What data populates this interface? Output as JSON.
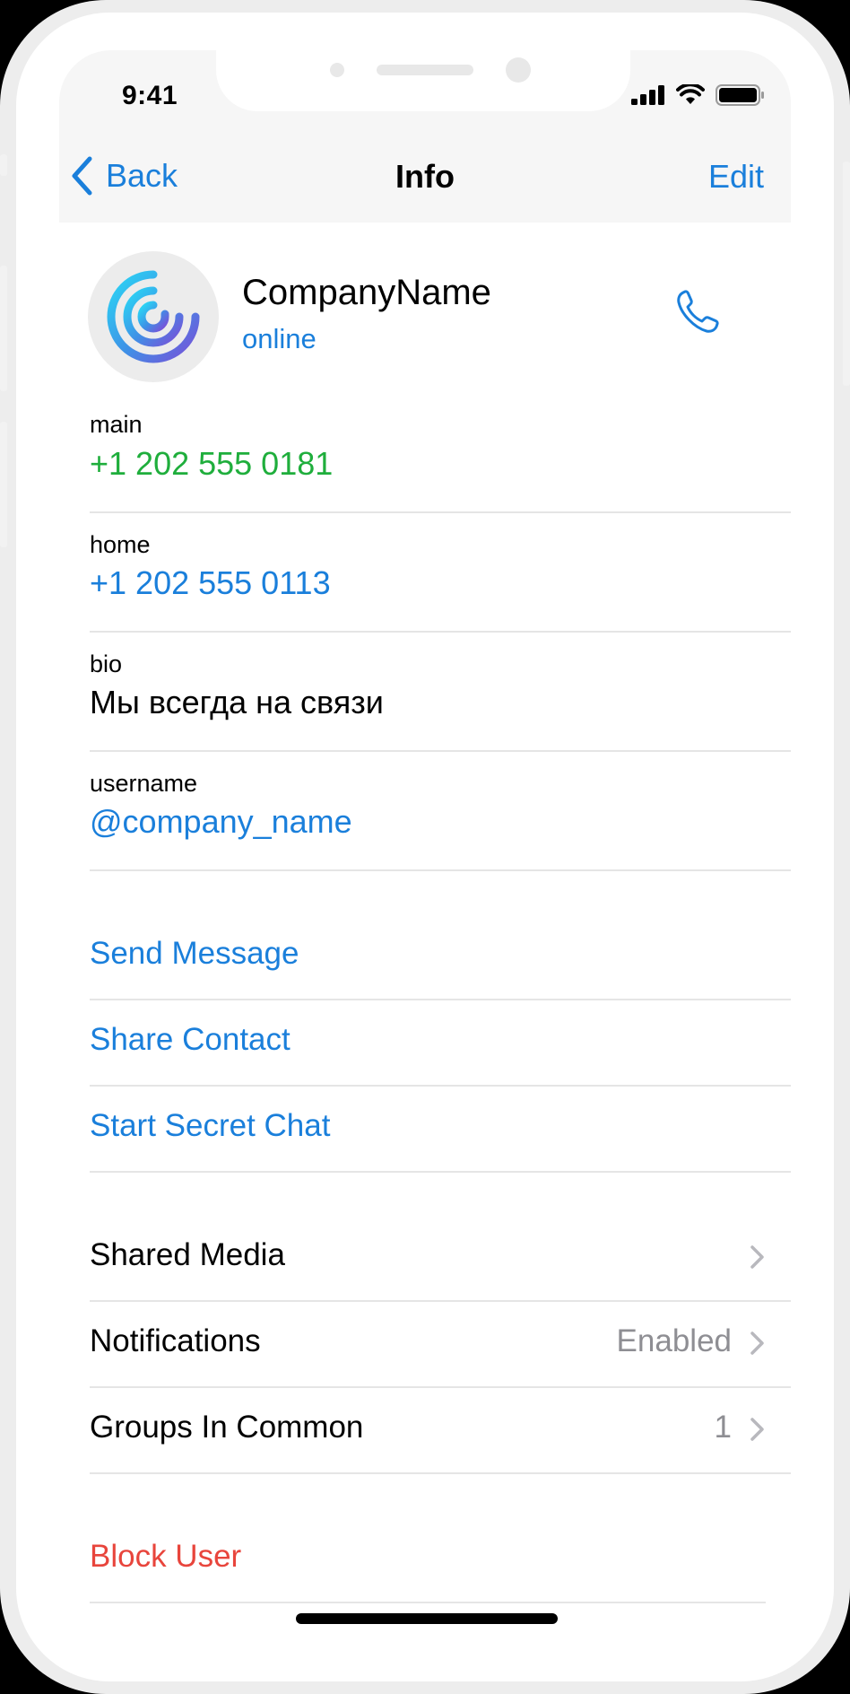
{
  "status_bar": {
    "time": "9:41"
  },
  "nav": {
    "back_label": "Back",
    "title": "Info",
    "edit_label": "Edit"
  },
  "profile": {
    "name": "CompanyName",
    "status": "online"
  },
  "fields": [
    {
      "label": "main",
      "value": "+1 202 555 0181",
      "color": "#1fae3c"
    },
    {
      "label": "home",
      "value": "+1 202 555 0113",
      "color": "#1a7fdb"
    },
    {
      "label": "bio",
      "value": "Мы всегда на связи",
      "color": "#000000"
    },
    {
      "label": "username",
      "value": "@company_name",
      "color": "#1a7fdb"
    }
  ],
  "actions": [
    {
      "label": "Send Message"
    },
    {
      "label": "Share Contact"
    },
    {
      "label": "Start Secret Chat"
    }
  ],
  "menu": [
    {
      "label": "Shared Media",
      "value": ""
    },
    {
      "label": "Notifications",
      "value": "Enabled"
    },
    {
      "label": "Groups In Common",
      "value": "1"
    }
  ],
  "danger": {
    "label": "Block User",
    "color": "#e8453c"
  },
  "colors": {
    "accent": "#1a7fdb",
    "phone_green": "#1fae3c",
    "danger": "#e8453c"
  },
  "icons": [
    "chevron-left-icon",
    "phone-icon",
    "chevron-right-icon",
    "signal-icon",
    "wifi-icon",
    "battery-icon",
    "company-logo"
  ]
}
